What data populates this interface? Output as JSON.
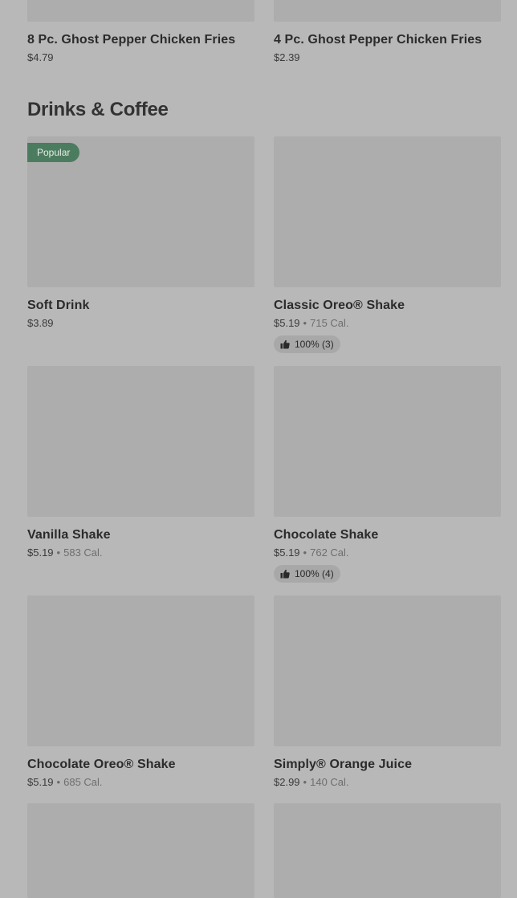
{
  "top_items": [
    {
      "name": "8 Pc. Ghost Pepper Chicken Fries",
      "price": "$4.79"
    },
    {
      "name": "4 Pc. Ghost Pepper Chicken Fries",
      "price": "$2.39"
    }
  ],
  "section": {
    "title": "Drinks & Coffee"
  },
  "items": [
    {
      "name": "Soft Drink",
      "price": "$3.89",
      "badge": "Popular"
    },
    {
      "name": "Classic Oreo® Shake",
      "price": "$5.19",
      "sep": "•",
      "calories": "715 Cal.",
      "rating": "100% (3)"
    },
    {
      "name": "Vanilla Shake",
      "price": "$5.19",
      "sep": "•",
      "calories": "583 Cal."
    },
    {
      "name": "Chocolate Shake",
      "price": "$5.19",
      "sep": "•",
      "calories": "762 Cal.",
      "rating": "100% (4)"
    },
    {
      "name": "Chocolate Oreo® Shake",
      "price": "$5.19",
      "sep": "•",
      "calories": "685 Cal."
    },
    {
      "name": "Simply® Orange Juice",
      "price": "$2.99",
      "sep": "•",
      "calories": "140 Cal."
    }
  ],
  "icons": {
    "rating": "thumbs-up-icon"
  },
  "colors": {
    "badge": "#4c7c5f",
    "background": "#b8b8b8",
    "image_placeholder": "#adadad"
  }
}
